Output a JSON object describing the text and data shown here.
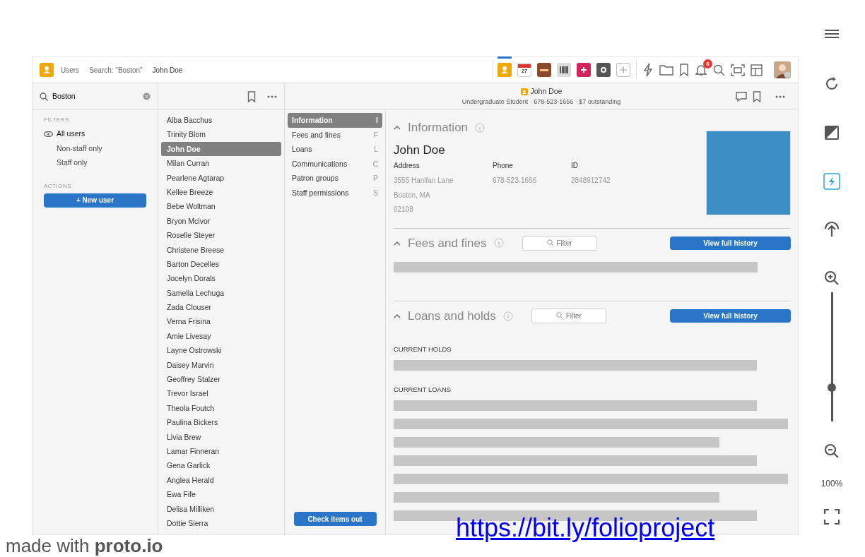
{
  "breadcrumbs": [
    {
      "label": "Users"
    },
    {
      "label": "Search: \"Boston\""
    },
    {
      "label": "John Doe"
    }
  ],
  "app_icons": [
    {
      "kind": "users",
      "selected": true
    },
    {
      "kind": "calendar",
      "label": "27",
      "selected": false
    },
    {
      "kind": "box",
      "selected": false
    },
    {
      "kind": "barcode",
      "selected": false
    },
    {
      "kind": "plus-square",
      "selected": false
    },
    {
      "kind": "gear",
      "selected": false
    },
    {
      "kind": "add",
      "selected": false
    }
  ],
  "notifications": {
    "count": "6"
  },
  "search": {
    "value": "Boston"
  },
  "filters": {
    "heading": "FILTERS",
    "items": [
      {
        "label": "All users",
        "selected": true
      },
      {
        "label": "Non-staff only",
        "selected": false
      },
      {
        "label": "Staff only",
        "selected": false
      }
    ]
  },
  "actions": {
    "heading": "ACTIONS",
    "new_user": "+ New user"
  },
  "users": [
    {
      "name": "Alba Bacchus",
      "selected": false
    },
    {
      "name": "Trinity Blom",
      "selected": false
    },
    {
      "name": "John Doe",
      "selected": true
    },
    {
      "name": "Milan Curran",
      "selected": false
    },
    {
      "name": "Pearlene Agtarap",
      "selected": false
    },
    {
      "name": "Kellee Breeze",
      "selected": false
    },
    {
      "name": "Bebe Woltman",
      "selected": false
    },
    {
      "name": "Bryon Mcivor",
      "selected": false
    },
    {
      "name": "Roselle Steyer",
      "selected": false
    },
    {
      "name": "Christene Breese",
      "selected": false
    },
    {
      "name": "Barton Decelles",
      "selected": false
    },
    {
      "name": "Jocelyn Dorals",
      "selected": false
    },
    {
      "name": "Samella Lechuga",
      "selected": false
    },
    {
      "name": "Zada Clouser",
      "selected": false
    },
    {
      "name": "Verna Frisina",
      "selected": false
    },
    {
      "name": "Amie Livesay",
      "selected": false
    },
    {
      "name": "Layne Ostrowski",
      "selected": false
    },
    {
      "name": "Daisey Marvin",
      "selected": false
    },
    {
      "name": "Geoffrey Stalzer",
      "selected": false
    },
    {
      "name": "Trevor Israel",
      "selected": false
    },
    {
      "name": "Theola Foutch",
      "selected": false
    },
    {
      "name": "Paulina Bickers",
      "selected": false
    },
    {
      "name": "Livia Brew",
      "selected": false
    },
    {
      "name": "Lamar Finneran",
      "selected": false
    },
    {
      "name": "Gena Garlick",
      "selected": false
    },
    {
      "name": "Anglea Herald",
      "selected": false
    },
    {
      "name": "Ewa Fife",
      "selected": false
    },
    {
      "name": "Delisa Milliken",
      "selected": false
    },
    {
      "name": "Dottie Sierra",
      "selected": false
    }
  ],
  "detail": {
    "title": "John Doe",
    "subtitle": "Undergraduate Student · 678-523-1656 · $7 outstanding"
  },
  "sections_nav": [
    {
      "label": "Information",
      "key": "I",
      "selected": true
    },
    {
      "label": "Fees and fines",
      "key": "F",
      "selected": false
    },
    {
      "label": "Loans",
      "key": "L",
      "selected": false
    },
    {
      "label": "Communications",
      "key": "C",
      "selected": false
    },
    {
      "label": "Patron groups",
      "key": "P",
      "selected": false
    },
    {
      "label": "Staff permissions",
      "key": "S",
      "selected": false
    }
  ],
  "check_out": "Check items out",
  "information": {
    "title": "Information",
    "name": "John Doe",
    "fields": [
      {
        "label": "Address",
        "values": [
          "3555 Hanifan Lane",
          "Boston, MA",
          "02108"
        ]
      },
      {
        "label": "Phone",
        "values": [
          "678-523-1656"
        ]
      },
      {
        "label": "ID",
        "values": [
          "2848912742"
        ]
      }
    ]
  },
  "fees": {
    "title": "Fees and fines",
    "filter_placeholder": "Filter",
    "button": "View full history"
  },
  "loans": {
    "title": "Loans and holds",
    "filter_placeholder": "Filter",
    "button": "View full history",
    "holds_heading": "CURRENT HOLDS",
    "loans_heading": "CURRENT LOANS"
  },
  "player": {
    "zoom": "100%",
    "zoom_slider": {
      "level": 0.26
    }
  },
  "footer": {
    "made_with": "made with",
    "brand": "proto.io",
    "link": "https://bit.ly/folioproject"
  }
}
